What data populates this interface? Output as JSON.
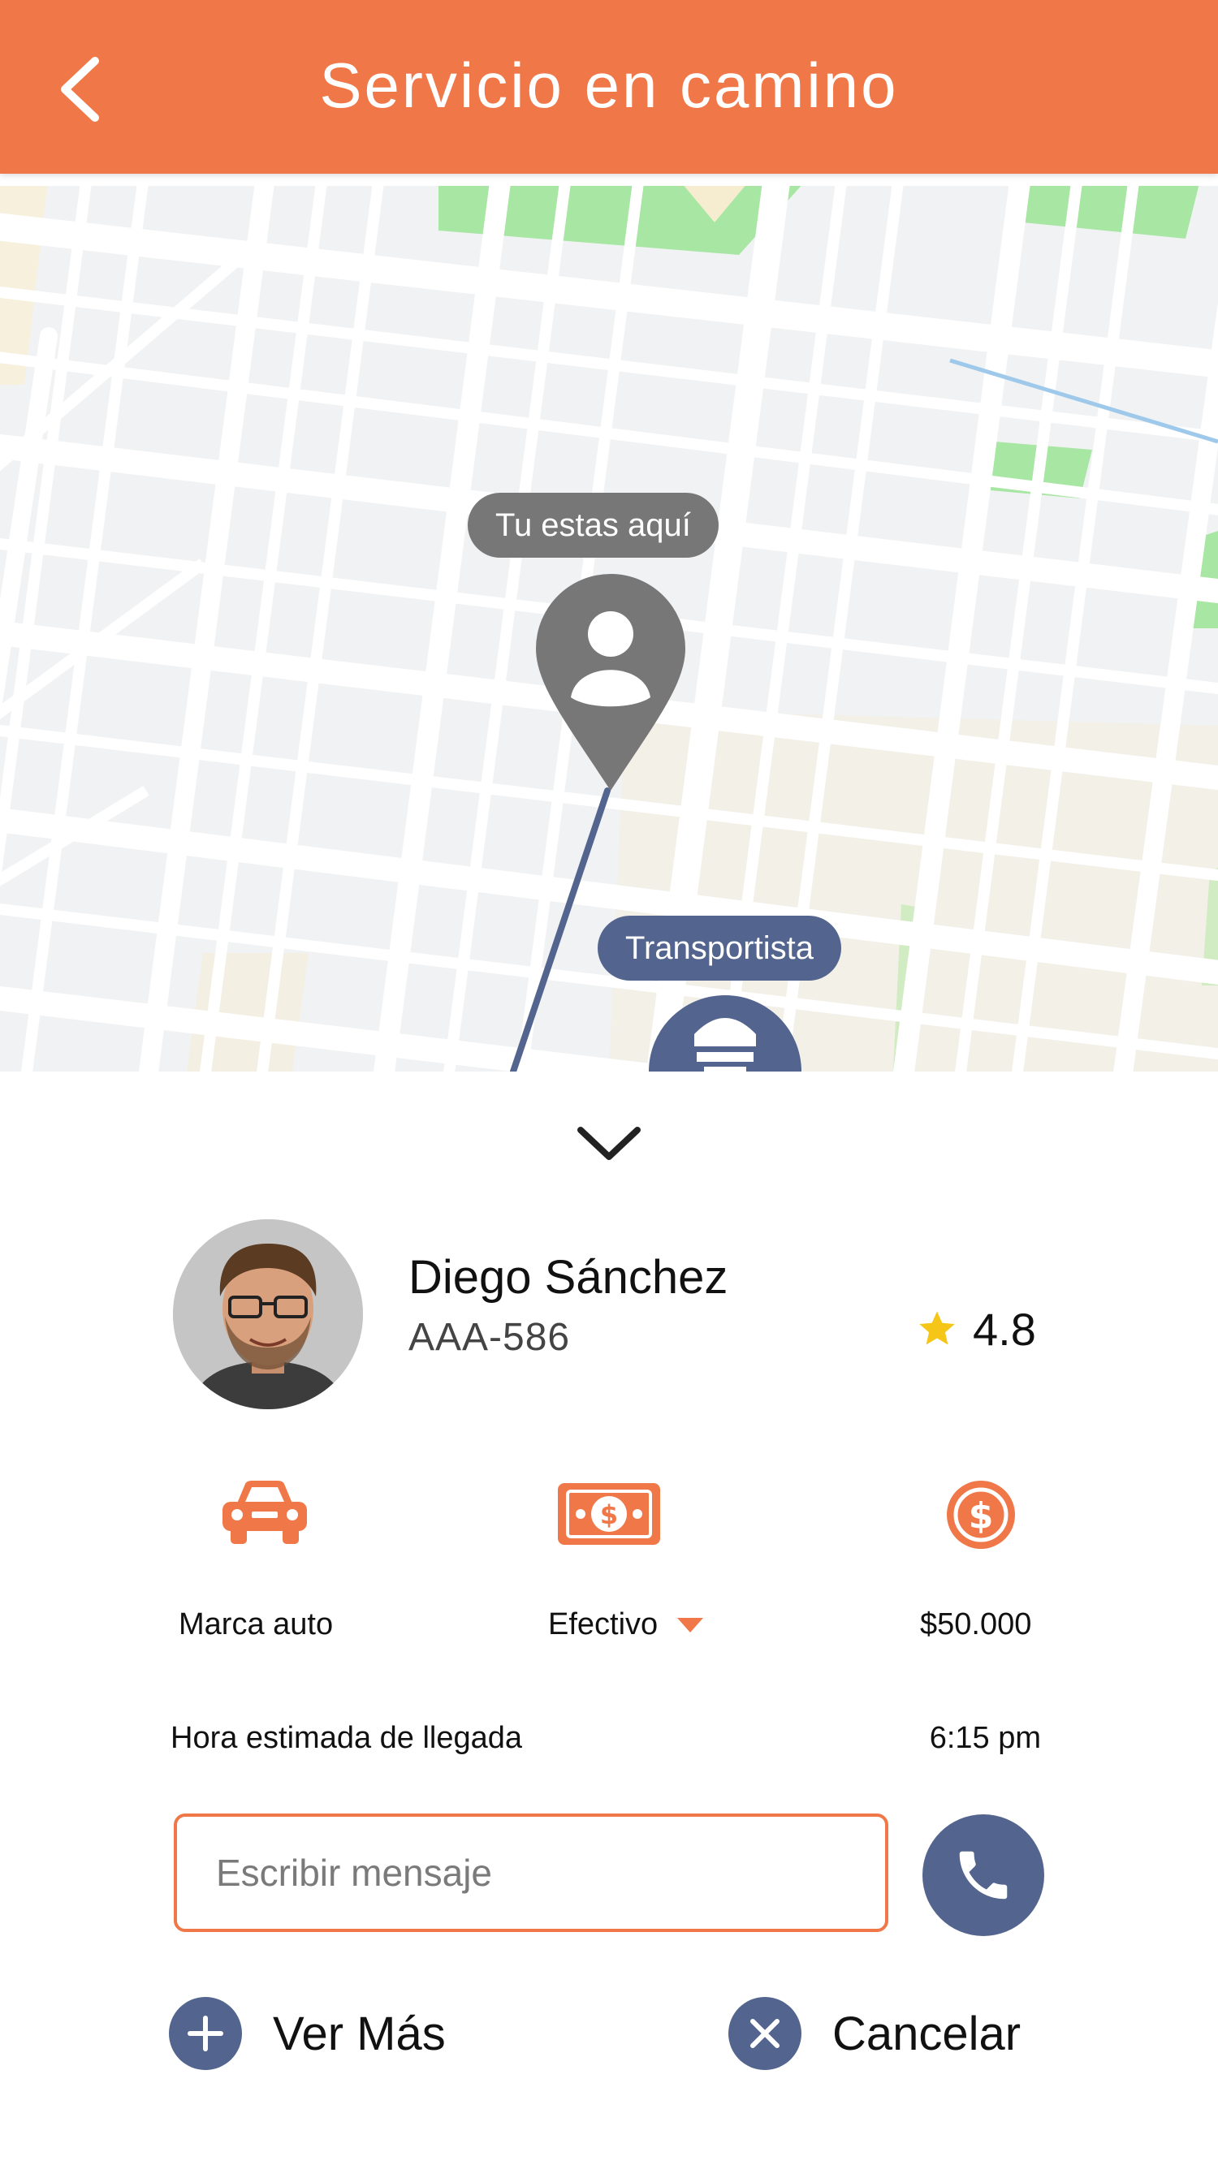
{
  "header": {
    "title": "Servicio en camino",
    "back_icon": "chevron-left-icon"
  },
  "map": {
    "user_pin_label": "Tu estas aquí",
    "driver_pin_label": "Transportista",
    "route_color": "#53658e"
  },
  "driver": {
    "name": "Diego Sánchez",
    "plate": "AAA-586",
    "rating": "4.8",
    "rating_icon": "star-icon"
  },
  "info": {
    "car_label": "Marca auto",
    "payment_label": "Efectivo",
    "price_label": "$50.000"
  },
  "eta": {
    "label": "Hora estimada de llegada",
    "value": "6:15 pm"
  },
  "message": {
    "placeholder": "Escribir mensaje"
  },
  "actions": {
    "more_label": "Ver Más",
    "cancel_label": "Cancelar"
  },
  "colors": {
    "accent": "#f07747",
    "secondary": "#53658e",
    "star": "#f5c518"
  }
}
